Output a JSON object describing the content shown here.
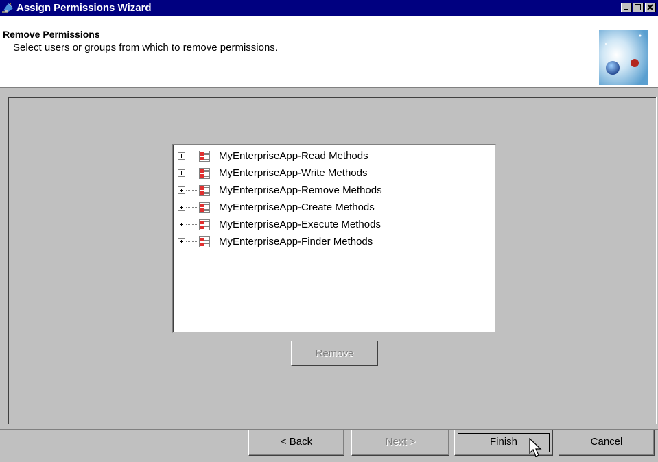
{
  "window": {
    "title": "Assign Permissions Wizard",
    "controls": [
      "minimize-icon",
      "maximize-icon",
      "close-icon"
    ]
  },
  "header": {
    "title": "Remove Permissions",
    "subtitle": "Select users or groups from which to remove permissions."
  },
  "tree": {
    "items": [
      {
        "label": "MyEnterpriseApp-Read Methods",
        "icon": "permission-role-icon"
      },
      {
        "label": "MyEnterpriseApp-Write Methods",
        "icon": "permission-role-icon"
      },
      {
        "label": "MyEnterpriseApp-Remove Methods",
        "icon": "permission-role-icon"
      },
      {
        "label": "MyEnterpriseApp-Create Methods",
        "icon": "permission-role-icon"
      },
      {
        "label": "MyEnterpriseApp-Execute Methods",
        "icon": "permission-role-icon"
      },
      {
        "label": "MyEnterpriseApp-Finder Methods",
        "icon": "permission-role-icon"
      }
    ]
  },
  "remove_button": {
    "label": "Remove",
    "enabled": false
  },
  "footer": {
    "back_label": "< Back",
    "next_label": "Next >",
    "finish_label": "Finish",
    "cancel_label": "Cancel"
  },
  "colors": {
    "titlebar": "#000080",
    "face": "#c0c0c0",
    "disabled_text": "#808080"
  }
}
